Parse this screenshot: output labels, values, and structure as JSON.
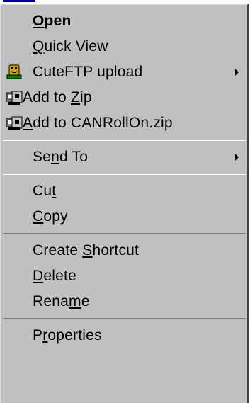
{
  "menu": {
    "items": [
      {
        "pre": "",
        "ul": "O",
        "post": "pen"
      },
      {
        "pre": "",
        "ul": "Q",
        "post": "uick View"
      },
      {
        "text": "CuteFTP upload",
        "icon": "cuteftp-icon"
      },
      {
        "pre": "Add to ",
        "ul": "Z",
        "post": "ip",
        "icon": "winzip-icon"
      },
      {
        "pre": "",
        "ul": "A",
        "post": "dd to CANRollOn.zip",
        "icon": "winzip-icon"
      },
      {
        "pre": "Se",
        "ul": "n",
        "post": "d To"
      },
      {
        "pre": "Cu",
        "ul": "t",
        "post": ""
      },
      {
        "pre": "",
        "ul": "C",
        "post": "opy"
      },
      {
        "pre": "Create ",
        "ul": "S",
        "post": "hortcut"
      },
      {
        "pre": "",
        "ul": "D",
        "post": "elete"
      },
      {
        "pre": "Rena",
        "ul": "m",
        "post": "e"
      },
      {
        "pre": "P",
        "ul": "r",
        "post": "operties"
      }
    ]
  },
  "colors": {
    "menu_bg": "#c0c0c0",
    "separator_dark": "#808080",
    "separator_light": "#ffffff",
    "text": "#000000"
  }
}
